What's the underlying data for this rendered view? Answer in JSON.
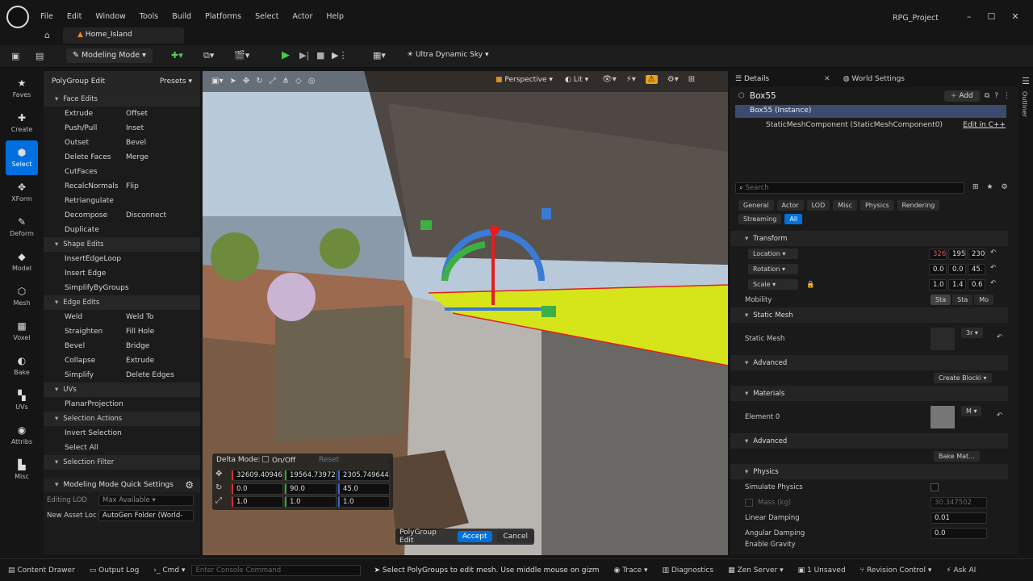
{
  "app": {
    "project": "RPG_Project",
    "tab": "Home_Island"
  },
  "menu": [
    "File",
    "Edit",
    "Window",
    "Tools",
    "Build",
    "Platforms",
    "Select",
    "Actor",
    "Help"
  ],
  "toolbar": {
    "mode": "Modeling Mode",
    "sky": "Ultra Dynamic Sky"
  },
  "leftbar": [
    {
      "label": "Faves",
      "icon": "★"
    },
    {
      "label": "Create",
      "icon": "✚"
    },
    {
      "label": "Select",
      "icon": "⬢"
    },
    {
      "label": "XForm",
      "icon": "✥"
    },
    {
      "label": "Deform",
      "icon": "✎"
    },
    {
      "label": "Model",
      "icon": "◆"
    },
    {
      "label": "Mesh",
      "icon": "⬡"
    },
    {
      "label": "Voxel",
      "icon": "▦"
    },
    {
      "label": "Bake",
      "icon": "◐"
    },
    {
      "label": "UVs",
      "icon": "▚"
    },
    {
      "label": "Attribs",
      "icon": "◉"
    },
    {
      "label": "Misc",
      "icon": "▙"
    }
  ],
  "tools": {
    "title": "PolyGroup Edit",
    "presets": "Presets",
    "face_edits": "Face Edits",
    "shape_edits": "Shape Edits",
    "edge_edits": "Edge Edits",
    "uvs": "UVs",
    "selection_actions": "Selection Actions",
    "selection_filter": "Selection Filter",
    "face": [
      [
        "Extrude",
        "Offset"
      ],
      [
        "Push/Pull",
        "Inset"
      ],
      [
        "Outset",
        "Bevel"
      ],
      [
        "Delete Faces",
        "Merge"
      ],
      [
        "CutFaces",
        ""
      ],
      [
        "RecalcNormals",
        "Flip"
      ],
      [
        "Retriangulate",
        ""
      ],
      [
        "Decompose",
        "Disconnect"
      ],
      [
        "Duplicate",
        ""
      ]
    ],
    "shape": [
      "InsertEdgeLoop",
      "Insert Edge",
      "SimplifyByGroups"
    ],
    "edge": [
      [
        "Weld",
        "Weld To"
      ],
      [
        "Straighten",
        "Fill Hole"
      ],
      [
        "Bevel",
        "Bridge"
      ],
      [
        "Collapse",
        "Extrude"
      ],
      [
        "Simplify",
        "Delete Edges"
      ]
    ],
    "uv_items": [
      "PlanarProjection"
    ],
    "sel_items": [
      "Invert Selection",
      "Select All"
    ],
    "quick": "Modeling Mode Quick Settings",
    "lod_label": "Editing LOD",
    "lod_value": "Max Available",
    "asset_label": "New Asset Loc",
    "asset_value": "AutoGen Folder (World-"
  },
  "viewport": {
    "perspective": "Perspective",
    "lit": "Lit",
    "delta_label": "Delta Mode:",
    "onoff": "On/Off",
    "reset": "Reset",
    "loc": [
      "32609.40946",
      "19564.73972",
      "2305.749644"
    ],
    "rot": [
      "0.0",
      "90.0",
      "45.0"
    ],
    "scale": [
      "1.0",
      "1.0",
      "1.0"
    ],
    "mode_label": "PolyGroup Edit",
    "accept": "Accept",
    "cancel": "Cancel"
  },
  "details": {
    "tab": "Details",
    "world_tab": "World Settings",
    "actor": "Box55",
    "add": "Add",
    "instance": "Box55 (Instance)",
    "component": "StaticMeshComponent (StaticMeshComponent0)",
    "edit_cpp": "Edit in C++",
    "search": "Search",
    "filters": [
      "General",
      "Actor",
      "LOD",
      "Misc",
      "Physics",
      "Rendering",
      "Streaming",
      "All"
    ],
    "transform": "Transform",
    "location": "Location",
    "rotation": "Rotation",
    "scale": "Scale",
    "loc_vals": [
      "326",
      "195",
      "230"
    ],
    "rot_vals": [
      "0.0",
      "0.0",
      "45."
    ],
    "scale_vals": [
      "1.0",
      "1.4",
      "0.6"
    ],
    "mobility": "Mobility",
    "mob_opts": [
      "Sta",
      "Sta",
      "Mo"
    ],
    "static_mesh_sect": "Static Mesh",
    "static_mesh": "Static Mesh",
    "sm_val": "3r",
    "advanced": "Advanced",
    "create_block": "Create Blocki",
    "materials": "Materials",
    "element0": "Element 0",
    "mat_val": "M",
    "advanced2": "Advanced",
    "bake": "Bake Mat...",
    "physics": "Physics",
    "sim": "Simulate Physics",
    "mass": "Mass (kg)",
    "mass_val": "30.347502",
    "lin": "Linear Damping",
    "lin_val": "0.01",
    "ang": "Angular Damping",
    "ang_val": "0.0",
    "grav": "Enable Gravity"
  },
  "status": {
    "drawer": "Content Drawer",
    "log": "Output Log",
    "cmd": "Cmd",
    "console": "Enter Console Command",
    "hint": "Select PolyGroups to edit mesh. Use middle mouse on gizm",
    "trace": "Trace",
    "diag": "Diagnostics",
    "zen": "Zen Server",
    "unsaved": "1 Unsaved",
    "rev": "Revision Control",
    "ask": "Ask AI",
    "outliner": "Outliner"
  }
}
